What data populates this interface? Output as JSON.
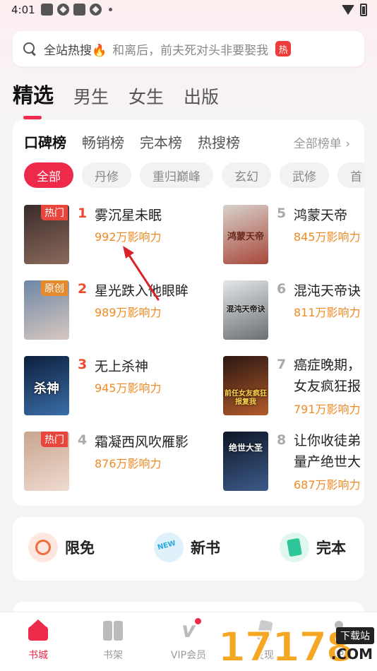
{
  "status": {
    "time": "4:01"
  },
  "search": {
    "hot_label": "全站热搜🔥",
    "suggestion": "和离后，前夫死对头非要娶我",
    "badge": "热"
  },
  "main_tabs": [
    "精选",
    "男生",
    "女生",
    "出版"
  ],
  "rank_tabs": [
    "口碑榜",
    "畅销榜",
    "完本榜",
    "热搜榜"
  ],
  "all_lists": "全部榜单 ›",
  "genres": [
    "全部",
    "丹修",
    "重归巅峰",
    "玄幻",
    "武修",
    "首"
  ],
  "books": [
    {
      "rank": "1",
      "title": "雾沉星未眠",
      "power": "992万影响力",
      "tag": "热门",
      "colors": [
        "#3a2b2a",
        "#8b6a5c"
      ]
    },
    {
      "rank": "2",
      "title": "星光跌入他眼眸",
      "power": "989万影响力",
      "tag": "原创",
      "colors": [
        "#6d87a6",
        "#d8c8c0"
      ]
    },
    {
      "rank": "3",
      "title": "无上杀神",
      "power": "945万影响力",
      "tag": "",
      "cover_text": "杀神",
      "colors": [
        "#0c1f3c",
        "#3b6ea8"
      ]
    },
    {
      "rank": "4",
      "title": "霜凝西风吹雁影",
      "power": "876万影响力",
      "tag": "热门",
      "colors": [
        "#c9a58e",
        "#eedad0"
      ]
    },
    {
      "rank": "5",
      "title": "鸿蒙天帝",
      "power": "845万影响力",
      "tag": "",
      "cover_text": "鸿蒙天帝",
      "colors": [
        "#d8d2cc",
        "#a8473a"
      ]
    },
    {
      "rank": "6",
      "title": "混沌天帝诀",
      "power": "811万影响力",
      "tag": "",
      "cover_text": "混沌天帝诀",
      "colors": [
        "#e4e6e8",
        "#6a6f74"
      ]
    },
    {
      "rank": "7",
      "title": "癌症晚期，女友疯狂报",
      "power": "791万影响力",
      "tag": "",
      "cover_text": "前任女友疯狂报复我",
      "colors": [
        "#2a1712",
        "#b35a2a"
      ]
    },
    {
      "rank": "8",
      "title": "让你收徒弟量产绝世大",
      "power": "687万影响力",
      "tag": "",
      "cover_text": "绝世大圣",
      "colors": [
        "#0e1626",
        "#3d5b8a"
      ]
    }
  ],
  "quick_entries": [
    "限免",
    "新书",
    "完本"
  ],
  "bottom_nav": [
    "书城",
    "书架",
    "VIP会员",
    "发现",
    "我的"
  ],
  "watermark": {
    "digits": "17178",
    "site": "下载站",
    "domain": ".COM"
  },
  "accent_color": "#ee2a4a"
}
